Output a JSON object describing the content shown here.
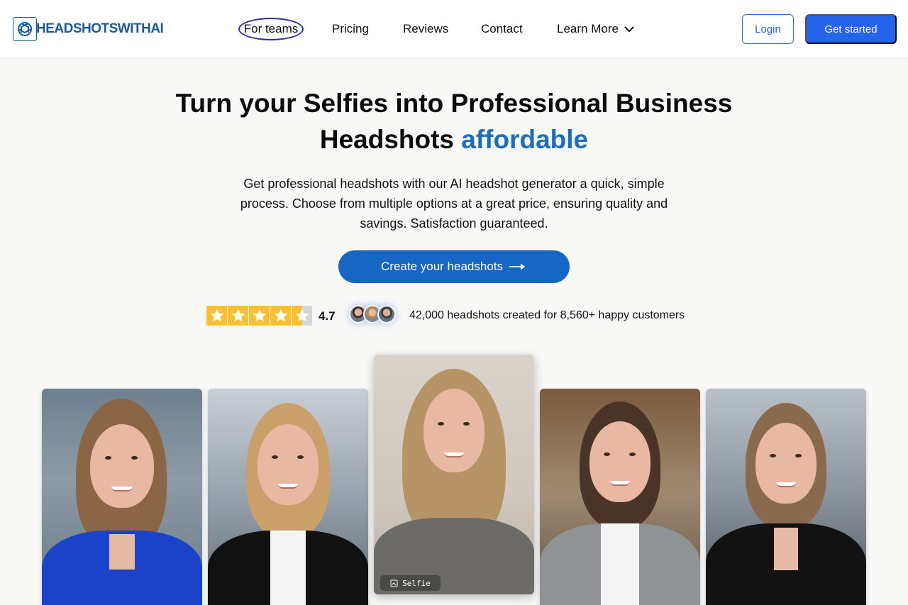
{
  "brand": {
    "logo_text_main": "HEADSHOTSWITH",
    "logo_text_ai": "AI"
  },
  "nav": {
    "items": [
      {
        "label": "For teams"
      },
      {
        "label": "Pricing"
      },
      {
        "label": "Reviews"
      },
      {
        "label": "Contact"
      },
      {
        "label": "Learn More"
      }
    ]
  },
  "header_actions": {
    "login_label": "Login",
    "get_started_label": "Get started"
  },
  "hero": {
    "title_main": "Turn your Selfies into Professional Business Headshots",
    "title_accent": "affordable",
    "subtitle": "Get professional headshots with our AI headshot generator a quick, simple process. Choose from multiple options at a great price, ensuring quality and savings. Satisfaction guaranteed.",
    "cta_label": "Create your headshots"
  },
  "social_proof": {
    "stars": 4.5,
    "rating": "4.7",
    "customers_text": "42,000 headshots created for 8,560+ happy customers"
  },
  "gallery": {
    "selfie_label": "Selfie"
  },
  "colors": {
    "primary": "#2563eb",
    "cta": "#1667c4",
    "accent_text": "#1a6ec0",
    "star": "#fbc02d",
    "nav_highlight": "#2b2fb0"
  }
}
